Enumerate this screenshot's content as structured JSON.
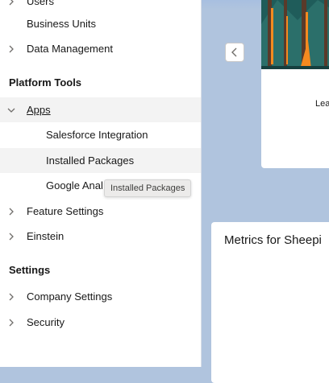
{
  "sidebar": {
    "top_partial": "Users",
    "business_units": "Business Units",
    "data_management": "Data Management",
    "platform_tools_heading": "Platform Tools",
    "apps": "Apps",
    "apps_children": [
      "Salesforce Integration",
      "Installed Packages",
      "Google Anal"
    ],
    "feature_settings": "Feature Settings",
    "einstein": "Einstein",
    "settings_heading": "Settings",
    "company_settings": "Company Settings",
    "security": "Security"
  },
  "tooltip": "Installed Packages",
  "cards": {
    "top_card_partial_text": "Lea",
    "metrics_title": "Metrics for Sheepi"
  },
  "colors": {
    "background": "#b0c4de",
    "sidebar_bg": "#ffffff",
    "selected_bg": "#f3f3f3",
    "illustration_teal": "#1f5c5a",
    "illustration_orange": "#f48a1f"
  },
  "icons": [
    "chevron-right-icon",
    "chevron-down-icon",
    "chevron-left-icon"
  ]
}
